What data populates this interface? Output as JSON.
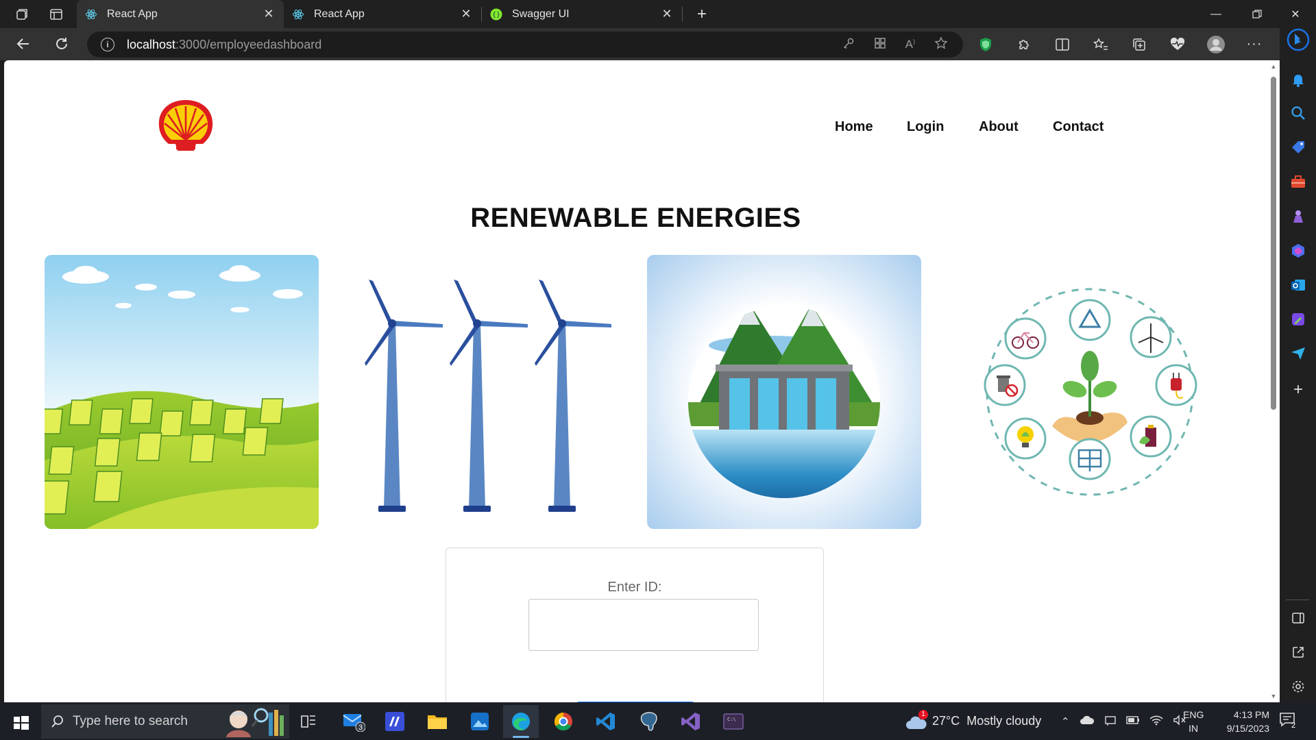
{
  "browser": {
    "tabs": [
      {
        "title": "React App",
        "active": true
      },
      {
        "title": "React App",
        "active": false
      },
      {
        "title": "Swagger UI",
        "active": false
      }
    ],
    "address": {
      "host": "localhost",
      "path": ":3000/employeedashboard"
    }
  },
  "page": {
    "nav": {
      "home": "Home",
      "login": "Login",
      "about": "About",
      "contact": "Contact"
    },
    "heading": "RENEWABLE ENERGIES",
    "form": {
      "label": "Enter ID:",
      "input_value": ""
    }
  },
  "taskbar": {
    "search_placeholder": "Type here to search",
    "mail_badge": "3",
    "weather": {
      "alert_count": "1",
      "temperature": "27°C",
      "condition": "Mostly cloudy"
    },
    "language": {
      "line1": "ENG",
      "line2": "IN"
    },
    "clock": {
      "time": "4:13 PM",
      "date": "9/15/2023"
    },
    "notification_count": "2"
  },
  "colors": {
    "accent_blue": "#0d6efd",
    "edge_bing": "#1a73e8",
    "shell_red": "#dd1d21",
    "shell_yellow": "#fbce07"
  }
}
